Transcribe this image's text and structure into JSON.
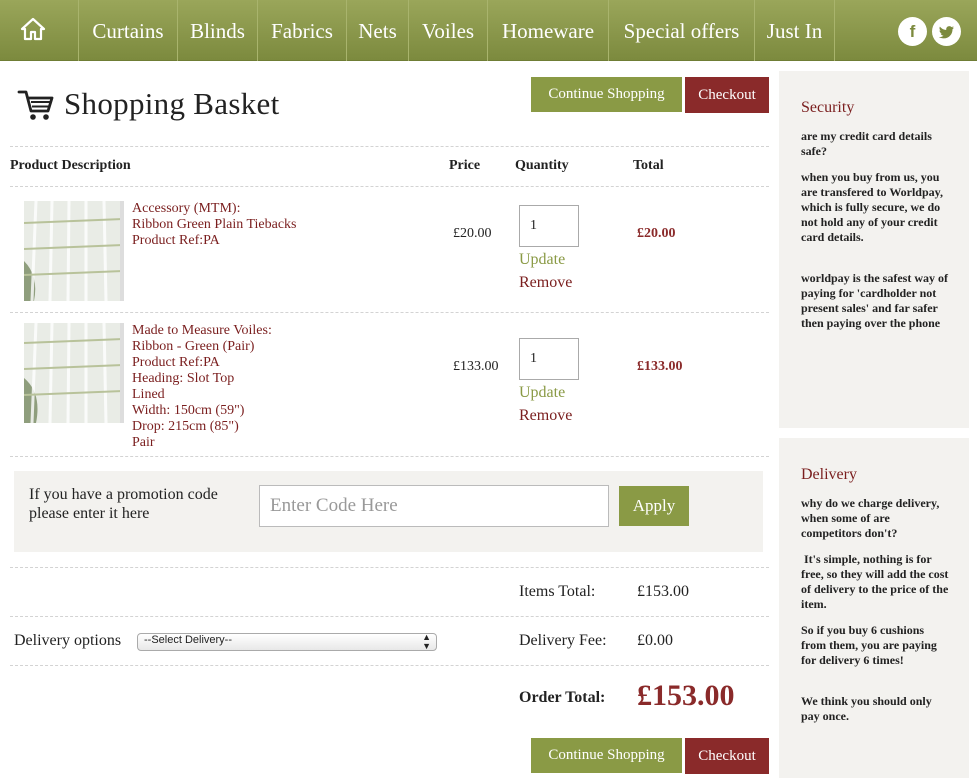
{
  "nav": {
    "home_icon": "home-icon",
    "items": [
      "Curtains",
      "Blinds",
      "Fabrics",
      "Nets",
      "Voiles",
      "Homeware",
      "Special offers",
      "Just In"
    ],
    "social": {
      "facebook": "f",
      "twitter": "twitter-icon"
    }
  },
  "page": {
    "title": "Shopping Basket",
    "cart_icon": "cart-icon",
    "continue_label": "Continue Shopping",
    "checkout_label": "Checkout"
  },
  "table": {
    "headers": [
      "Product Description",
      "Price",
      "Quantity",
      "Total"
    ],
    "rows": [
      {
        "lines": [
          "Accessory (MTM):",
          "Ribbon Green Plain Tiebacks",
          "Product Ref:PA"
        ],
        "price": "£20.00",
        "qty": "1",
        "total": "£20.00"
      },
      {
        "lines": [
          "Made to Measure Voiles:",
          "Ribbon - Green (Pair)",
          "Product Ref:PA",
          "Heading: Slot Top",
          "Lined",
          "Width: 150cm (59\")",
          "Drop: 215cm (85\")",
          "Pair"
        ],
        "price": "£133.00",
        "qty": "1",
        "total": "£133.00"
      }
    ],
    "update_label": "Update",
    "remove_label": "Remove"
  },
  "promo": {
    "label_line1": "If you have a promotion code",
    "label_line2": "please enter it here",
    "placeholder": "Enter Code Here",
    "apply_label": "Apply"
  },
  "summary": {
    "items_total_label": "Items Total:",
    "items_total": "£153.00",
    "delivery_options_label": "Delivery options",
    "delivery_select": "--Select Delivery--",
    "delivery_fee_label": "Delivery Fee:",
    "delivery_fee": "£0.00",
    "order_total_label": "Order Total:",
    "order_total": "£153.00"
  },
  "sidebar": {
    "security": {
      "title": "Security",
      "paragraphs": [
        "are my credit card details safe?",
        "when you buy from us, you are transfered to Worldpay, which is fully secure, we do not hold any of your credit card details.",
        "worldpay is the safest way of paying for 'cardholder not present sales' and far safer then paying over the phone"
      ]
    },
    "delivery": {
      "title": "Delivery",
      "paragraphs": [
        "why do we charge delivery, when some of are competitors don't?",
        " It's simple, nothing is for free, so they will add the cost of delivery to the price of the item.",
        "So if you buy 6 cushions from them, you are paying for delivery 6 times!",
        "We think you should only pay once."
      ]
    }
  }
}
